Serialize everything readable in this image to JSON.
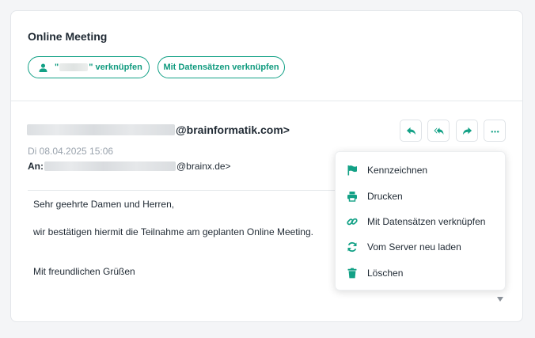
{
  "card": {
    "title": "Online Meeting",
    "link_contact_open_quote": "\"",
    "link_contact_suffix": "\" verknüpfen",
    "link_records_button": "Mit Datensätzen verknüpfen"
  },
  "email": {
    "sender_domain": "@brainformatik.com>",
    "date": "Di 08.04.2025 15:06",
    "to_label": "An:",
    "to_domain": "@brainx.de>",
    "body": {
      "greeting": "Sehr geehrte Damen und Herren,",
      "line1": "wir bestätigen hiermit die Teilnahme am geplanten Online Meeting.",
      "closing": "Mit freundlichen Grüßen"
    }
  },
  "toolbar": {
    "reply_icon": "reply-icon",
    "reply_all_icon": "reply-all-icon",
    "forward_icon": "forward-icon",
    "more_icon": "more-icon"
  },
  "menu": {
    "items": [
      {
        "label": "Kennzeichnen",
        "icon": "flag-icon"
      },
      {
        "label": "Drucken",
        "icon": "printer-icon"
      },
      {
        "label": "Mit Datensätzen verknüpfen",
        "icon": "link-icon"
      },
      {
        "label": "Vom Server neu laden",
        "icon": "refresh-icon"
      },
      {
        "label": "Löschen",
        "icon": "trash-icon"
      }
    ]
  },
  "colors": {
    "accent": "#13a186",
    "text": "#1f2933",
    "muted": "#9aa3ad"
  }
}
